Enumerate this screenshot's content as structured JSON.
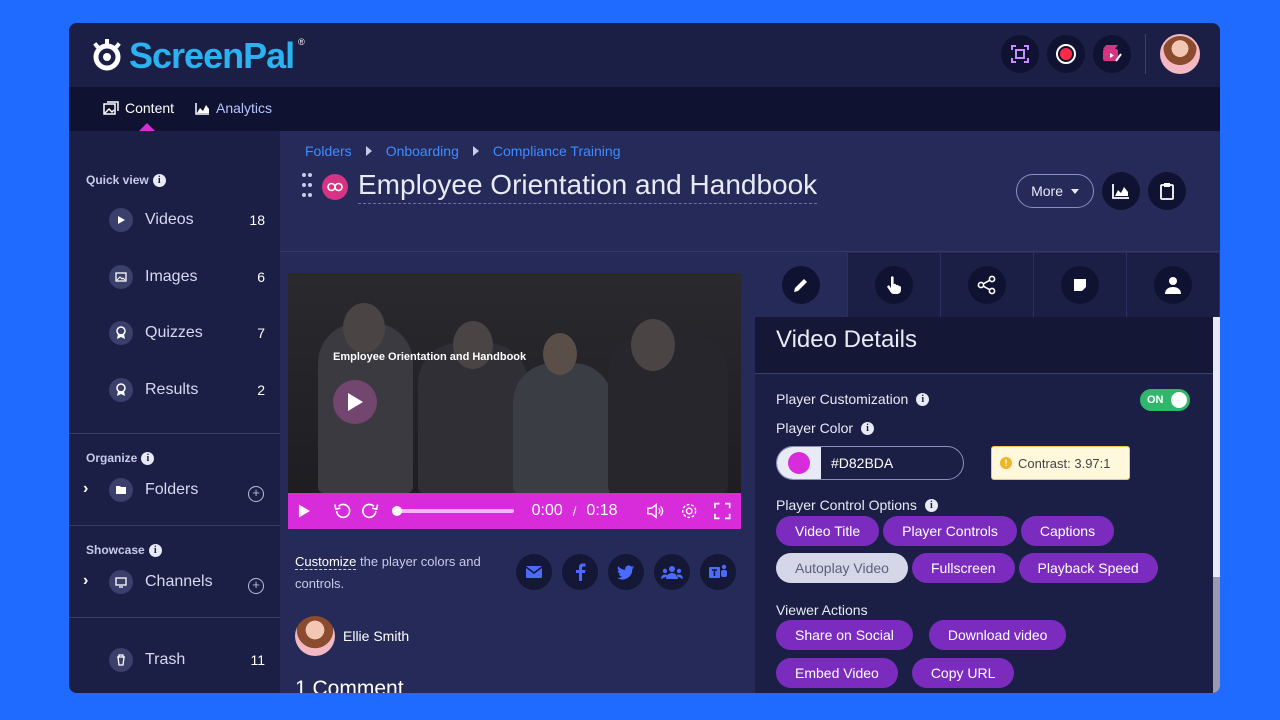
{
  "app": {
    "brand": "ScreenPal",
    "reg_mark": "®",
    "accent": "#d82bda"
  },
  "nav": {
    "content": "Content",
    "analytics": "Analytics"
  },
  "sidebar": {
    "quick_view": "Quick view",
    "items": [
      {
        "label": "Videos",
        "count": "18"
      },
      {
        "label": "Images",
        "count": "6"
      },
      {
        "label": "Quizzes",
        "count": "7"
      },
      {
        "label": "Results",
        "count": "2"
      }
    ],
    "organize": "Organize",
    "folders": "Folders",
    "showcase": "Showcase",
    "channels": "Channels",
    "trash": "Trash",
    "trash_count": "11"
  },
  "breadcrumb": [
    "Folders",
    "Onboarding",
    "Compliance Training"
  ],
  "page": {
    "title": "Employee Orientation and Handbook",
    "more": "More"
  },
  "video": {
    "title": "Employee Orientation and Handbook",
    "current": "0:00",
    "separator": "/",
    "duration": "0:18",
    "progress": 0
  },
  "customize": {
    "link": "Customize",
    "text": " the player colors and controls."
  },
  "author": {
    "name": "Ellie Smith"
  },
  "comments": {
    "heading": "1 Comment"
  },
  "panel": {
    "title": "Video Details",
    "player_customization": "Player Customization",
    "toggle": "ON",
    "player_color_label": "Player Color",
    "player_color": "#D82BDA",
    "contrast": "Contrast: 3.97:1",
    "control_options_label": "Player Control Options",
    "control_options": [
      {
        "label": "Video Title",
        "enabled": true
      },
      {
        "label": "Player Controls",
        "enabled": true
      },
      {
        "label": "Captions",
        "enabled": true
      },
      {
        "label": "Autoplay Video",
        "enabled": false
      },
      {
        "label": "Fullscreen",
        "enabled": true
      },
      {
        "label": "Playback Speed",
        "enabled": true
      }
    ],
    "viewer_actions_label": "Viewer Actions",
    "viewer_actions": [
      {
        "label": "Share on Social"
      },
      {
        "label": "Download video"
      },
      {
        "label": "Embed Video"
      },
      {
        "label": "Copy URL"
      }
    ]
  }
}
